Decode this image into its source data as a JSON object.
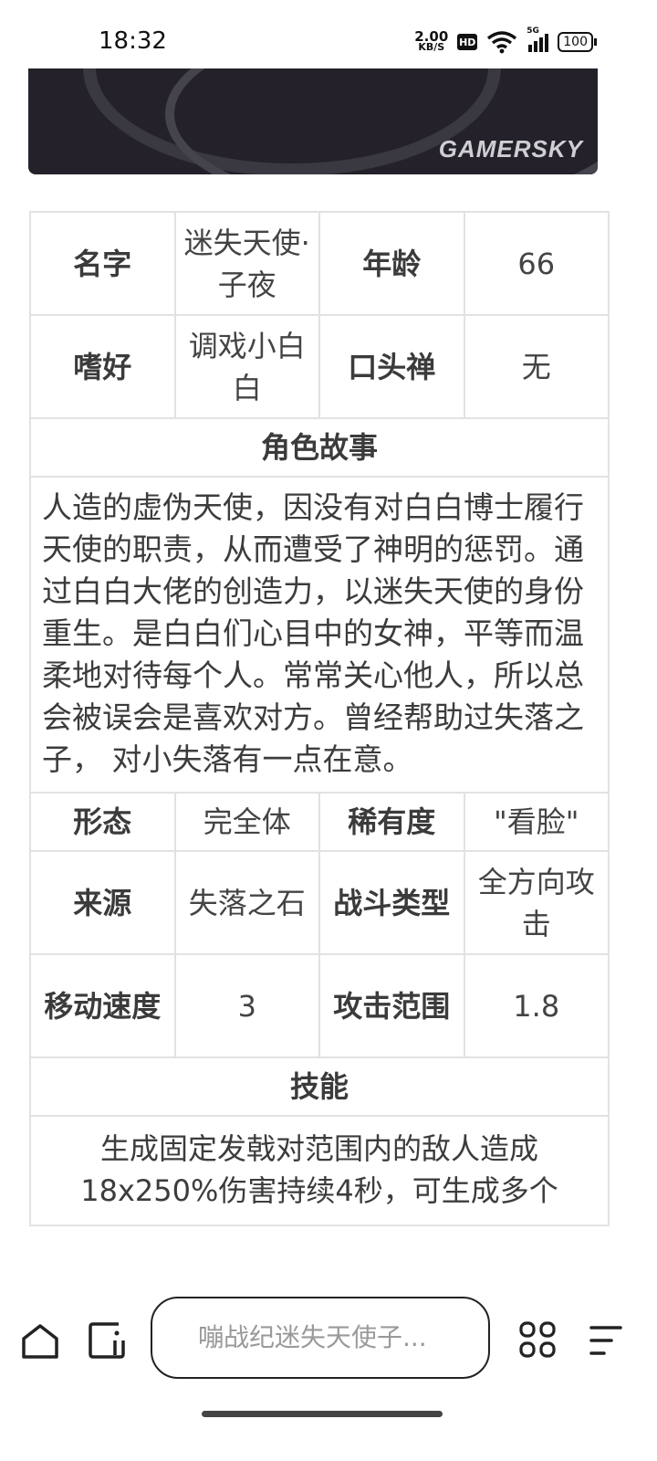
{
  "status": {
    "time": "18:32",
    "net_speed_value": "2.00",
    "net_speed_unit": "KB/S",
    "hd_label": "HD",
    "signal_label": "5G",
    "battery": "100"
  },
  "banner": {
    "watermark": "GAMERSKY"
  },
  "table": {
    "row1": {
      "name_label": "名字",
      "name_value": "迷失天使·子夜",
      "age_label": "年龄",
      "age_value": "66"
    },
    "row2": {
      "hobby_label": "嗜好",
      "hobby_value": "调戏小白白",
      "catchphrase_label": "口头禅",
      "catchphrase_value": "无"
    },
    "story_header": "角色故事",
    "story_text": "人造的虚伪天使，因没有对白白博士履行天使的职责，从而遭受了神明的惩罚。通过白白大佬的创造力，以迷失天使的身份重生。是白白们心目中的女神，平等而温柔地对待每个人。常常关心他人，所以总会被误会是喜欢对方。曾经帮助过失落之子， 对小失落有一点在意。",
    "row3": {
      "form_label": "形态",
      "form_value": "完全体",
      "rarity_label": "稀有度",
      "rarity_value": "\"看脸\""
    },
    "row4": {
      "source_label": "来源",
      "source_value": "失落之石",
      "combat_label": "战斗类型",
      "combat_value": "全方向攻击"
    },
    "row5": {
      "speed_label": "移动速度",
      "speed_value": "3",
      "range_label": "攻击范围",
      "range_value": "1.8"
    },
    "skill_header": "技能",
    "skill_text": "生成固定发戟对范围内的敌人造成18x250%伤害持续4秒，可生成多个"
  },
  "bottom": {
    "search_text": "嘣战纪迷失天使子..."
  }
}
